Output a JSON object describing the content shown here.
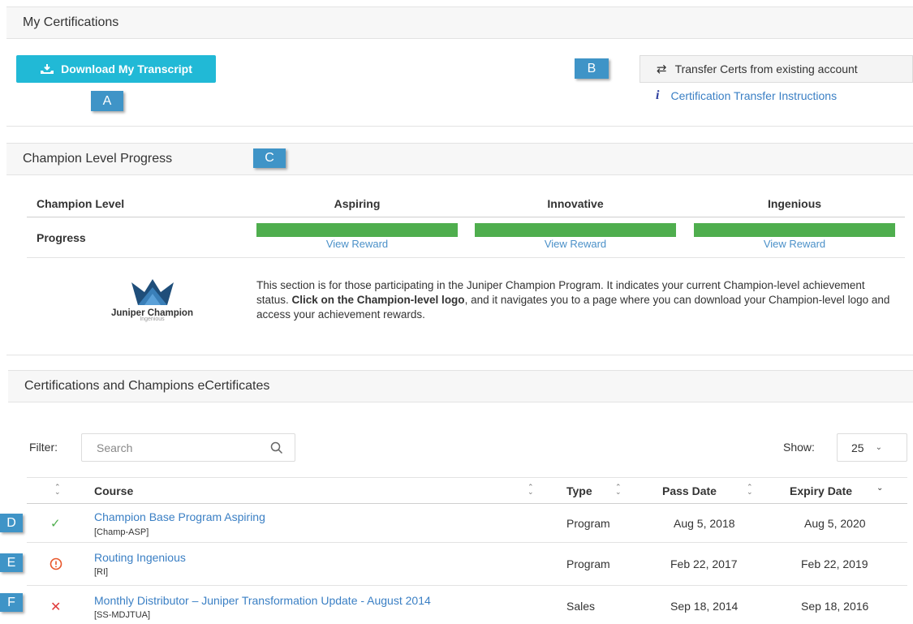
{
  "sections": {
    "my_certs": "My Certifications",
    "champion": "Champion Level Progress",
    "ecerts": "Certifications and Champions eCertificates"
  },
  "actions": {
    "download": "Download My Transcript",
    "transfer": "Transfer Certs from existing account",
    "instructions": "Certification Transfer Instructions"
  },
  "markers": {
    "a": "A",
    "b": "B",
    "c": "C",
    "d": "D",
    "e": "E",
    "f": "F"
  },
  "champion": {
    "col_level": "Champion Level",
    "row_progress": "Progress",
    "levels": [
      {
        "name": "Aspiring",
        "reward": "View Reward",
        "progress": 1.0
      },
      {
        "name": "Innovative",
        "reward": "View Reward",
        "progress": 1.0
      },
      {
        "name": "Ingenious",
        "reward": "View Reward",
        "progress": 1.0
      }
    ],
    "logo_text": "Juniper Champion",
    "logo_sub": "Ingenious",
    "desc_1": "This section is for those participating in the Juniper Champion Program. It indicates your current Champion-level achievement status. ",
    "desc_bold": "Click on the Champion-level logo",
    "desc_2": ", and it navigates you to a page where you can download your Champion-level logo and access your achievement rewards."
  },
  "table": {
    "filter_label": "Filter:",
    "search_placeholder": "Search",
    "show_label": "Show:",
    "show_value": "25",
    "headers": {
      "course": "Course",
      "type": "Type",
      "pass": "Pass Date",
      "expiry": "Expiry Date"
    },
    "rows": [
      {
        "status": "passed",
        "title": "Champion Base Program Aspiring",
        "code": "[Champ-ASP]",
        "type": "Program",
        "pass": "Aug 5, 2018",
        "expiry": "Aug 5, 2020"
      },
      {
        "status": "warning",
        "title": "Routing Ingenious",
        "code": "[RI]",
        "type": "Program",
        "pass": "Feb 22, 2017",
        "expiry": "Feb 22, 2019"
      },
      {
        "status": "expired",
        "title": "Monthly Distributor – Juniper Transformation Update - August 2014",
        "code": "[SS-MDJTUA]",
        "type": "Sales",
        "pass": "Sep 18, 2014",
        "expiry": "Sep 18, 2016"
      }
    ]
  },
  "colors": {
    "accent": "#21b9d6",
    "marker": "#3f94c7",
    "progress": "#4fae4e",
    "link": "#3a7fc4",
    "ok": "#4fae4e",
    "warn": "#e8562a",
    "error": "#e03c3c"
  }
}
